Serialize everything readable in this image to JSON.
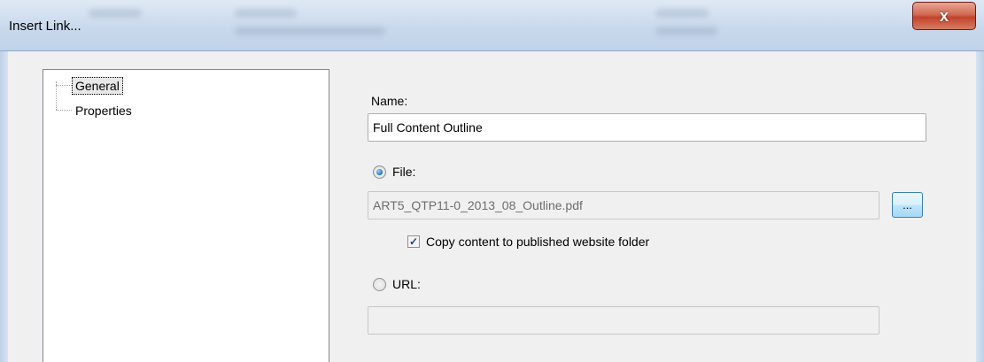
{
  "window": {
    "title": "Insert Link...",
    "close_glyph": "x"
  },
  "tree": {
    "items": [
      {
        "label": "General",
        "selected": true
      },
      {
        "label": "Properties",
        "selected": false
      }
    ]
  },
  "form": {
    "name_label": "Name:",
    "name_value": "Full Content Outline",
    "file_option_label": "File:",
    "file_selected": true,
    "file_value": "ART5_QTP11-0_2013_08_Outline.pdf",
    "browse_label": "...",
    "copy_label": "Copy content to published website folder",
    "copy_checked": true,
    "url_option_label": "URL:",
    "url_value": ""
  },
  "icons": {
    "close": "close-icon",
    "check": "checkmark-icon",
    "radio": "radio-dot-icon"
  },
  "colors": {
    "close_button": "#c2442c",
    "dialog_background": "#f0f0f0",
    "title_bar": "#c9d9ec"
  }
}
